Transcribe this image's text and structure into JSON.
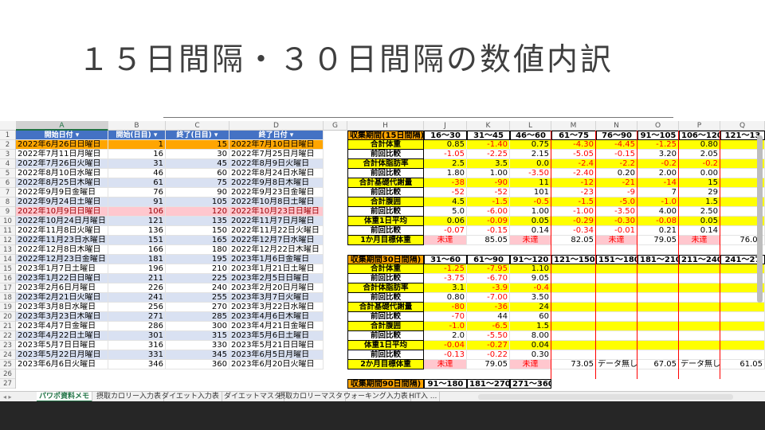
{
  "slide": {
    "title": "１５日間隔・３０日間隔の数値内訳"
  },
  "columns": [
    "A",
    "B",
    "C",
    "D",
    "G",
    "H",
    "J",
    "K",
    "L",
    "M",
    "N",
    "O",
    "P",
    "Q"
  ],
  "rows": [
    "1",
    "2",
    "3",
    "4",
    "5",
    "6",
    "7",
    "8",
    "9",
    "10",
    "11",
    "12",
    "13",
    "14",
    "15",
    "16",
    "17",
    "18",
    "19",
    "20",
    "21",
    "22",
    "23",
    "24",
    "25",
    "26",
    "27"
  ],
  "table_left": {
    "headers": [
      "開始日付",
      "開始(日目)",
      "終了(日目)",
      "終了日付"
    ],
    "rows": [
      [
        "2022年6月26日日曜日",
        "1",
        "15",
        "2022年7月10日日曜日"
      ],
      [
        "2022年7月11日月曜日",
        "16",
        "30",
        "2022年7月25日月曜日"
      ],
      [
        "2022年7月26日火曜日",
        "31",
        "45",
        "2022年8月9日火曜日"
      ],
      [
        "2022年8月10日水曜日",
        "46",
        "60",
        "2022年8月24日水曜日"
      ],
      [
        "2022年8月25日木曜日",
        "61",
        "75",
        "2022年9月8日木曜日"
      ],
      [
        "2022年9月9日金曜日",
        "76",
        "90",
        "2022年9月23日金曜日"
      ],
      [
        "2022年9月24日土曜日",
        "91",
        "105",
        "2022年10月8日土曜日"
      ],
      [
        "2022年10月9日日曜日",
        "106",
        "120",
        "2022年10月23日日曜日"
      ],
      [
        "2022年10月24日月曜日",
        "121",
        "135",
        "2022年11月7日月曜日"
      ],
      [
        "2022年11月8日火曜日",
        "136",
        "150",
        "2022年11月22日火曜日"
      ],
      [
        "2022年11月23日水曜日",
        "151",
        "165",
        "2022年12月7日水曜日"
      ],
      [
        "2022年12月8日木曜日",
        "166",
        "180",
        "2022年12月22日木曜日"
      ],
      [
        "2022年12月23日金曜日",
        "181",
        "195",
        "2023年1月6日金曜日"
      ],
      [
        "2023年1月7日土曜日",
        "196",
        "210",
        "2023年1月21日土曜日"
      ],
      [
        "2023年1月22日日曜日",
        "211",
        "225",
        "2023年2月5日日曜日"
      ],
      [
        "2023年2月6日月曜日",
        "226",
        "240",
        "2023年2月20日月曜日"
      ],
      [
        "2023年2月21日火曜日",
        "241",
        "255",
        "2023年3月7日火曜日"
      ],
      [
        "2023年3月8日水曜日",
        "256",
        "270",
        "2023年3月22日水曜日"
      ],
      [
        "2023年3月23日木曜日",
        "271",
        "285",
        "2023年4月6日木曜日"
      ],
      [
        "2023年4月7日金曜日",
        "286",
        "300",
        "2023年4月21日金曜日"
      ],
      [
        "2023年4月22日土曜日",
        "301",
        "315",
        "2023年5月6日土曜日"
      ],
      [
        "2023年5月7日日曜日",
        "316",
        "330",
        "2023年5月21日日曜日"
      ],
      [
        "2023年5月22日月曜日",
        "331",
        "345",
        "2023年6月5日月曜日"
      ],
      [
        "2023年6月6日火曜日",
        "346",
        "360",
        "2023年6月20日火曜日"
      ]
    ]
  },
  "table_15": {
    "header": "収集期間(15日間隔)",
    "periods": [
      "16～30",
      "31～45",
      "46～60",
      "61～75",
      "76～90",
      "91～105",
      "106～120",
      "121～13"
    ],
    "rows": [
      {
        "label": "合計体重",
        "values": [
          "0.85",
          "-1.40",
          "0.75",
          "-4.30",
          "-4.45",
          "-1.25",
          "0.80",
          ""
        ]
      },
      {
        "label": "前回比較",
        "values": [
          "-1.05",
          "-2.25",
          "2.15",
          "-5.05",
          "-0.15",
          "3.20",
          "2.05",
          ""
        ]
      },
      {
        "label": "合計体脂肪率",
        "values": [
          "2.5",
          "3.5",
          "0.0",
          "-2.4",
          "-2.2",
          "-0.2",
          "-0.2",
          ""
        ]
      },
      {
        "label": "前回比較",
        "values": [
          "1.80",
          "1.00",
          "-3.50",
          "-2.40",
          "0.20",
          "2.00",
          "0.00",
          ""
        ]
      },
      {
        "label": "合計基礎代謝量",
        "values": [
          "-38",
          "-90",
          "11",
          "-12",
          "-21",
          "-14",
          "15",
          ""
        ]
      },
      {
        "label": "前回比較",
        "values": [
          "-52",
          "-52",
          "101",
          "-23",
          "-9",
          "7",
          "29",
          ""
        ]
      },
      {
        "label": "合計腹囲",
        "values": [
          "4.5",
          "-1.5",
          "-0.5",
          "-1.5",
          "-5.0",
          "-1.0",
          "1.5",
          ""
        ]
      },
      {
        "label": "前回比較",
        "values": [
          "5.0",
          "-6.00",
          "1.00",
          "-1.00",
          "-3.50",
          "4.00",
          "2.50",
          ""
        ]
      },
      {
        "label": "体重1日平均",
        "values": [
          "0.06",
          "-0.09",
          "0.05",
          "-0.29",
          "-0.30",
          "-0.08",
          "0.05",
          ""
        ]
      },
      {
        "label": "前回比較",
        "values": [
          "-0.07",
          "-0.15",
          "0.14",
          "-0.34",
          "-0.01",
          "0.21",
          "0.14",
          ""
        ]
      },
      {
        "label": "1か月目標体重",
        "values": [
          "未達",
          "85.05",
          "未達",
          "82.05",
          "未達",
          "79.05",
          "未達",
          "76.05"
        ]
      }
    ]
  },
  "table_30": {
    "header": "収集期間30日間隔)",
    "periods": [
      "31～60",
      "61～90",
      "91～120",
      "121～150",
      "151～180",
      "181～210",
      "211～240",
      "241～27"
    ],
    "rows": [
      {
        "label": "合計体重",
        "values": [
          "-1.25",
          "-7.95",
          "1.10",
          "",
          "",
          "",
          "",
          ""
        ]
      },
      {
        "label": "前回比較",
        "values": [
          "-3.75",
          "-6.70",
          "9.05",
          "",
          "",
          "",
          "",
          ""
        ]
      },
      {
        "label": "合計体脂肪率",
        "values": [
          "3.1",
          "-3.9",
          "-0.4",
          "",
          "",
          "",
          "",
          ""
        ]
      },
      {
        "label": "前回比較",
        "values": [
          "0.80",
          "-7.00",
          "3.50",
          "",
          "",
          "",
          "",
          ""
        ]
      },
      {
        "label": "合計基礎代謝量",
        "values": [
          "-80",
          "-36",
          "24",
          "",
          "",
          "",
          "",
          ""
        ]
      },
      {
        "label": "前回比較",
        "values": [
          "-70",
          "44",
          "60",
          "",
          "",
          "",
          "",
          ""
        ]
      },
      {
        "label": "合計腹囲",
        "values": [
          "-1.0",
          "-6.5",
          "1.5",
          "",
          "",
          "",
          "",
          ""
        ]
      },
      {
        "label": "前回比較",
        "values": [
          "2.0",
          "-5.50",
          "8.00",
          "",
          "",
          "",
          "",
          ""
        ]
      },
      {
        "label": "体重1日平均",
        "values": [
          "-0.04",
          "-0.27",
          "0.04",
          "",
          "",
          "",
          "",
          ""
        ]
      },
      {
        "label": "前回比較",
        "values": [
          "-0.13",
          "-0.22",
          "0.30",
          "",
          "",
          "",
          "",
          ""
        ]
      },
      {
        "label": "2か月目標体重",
        "values": [
          "未達",
          "79.05",
          "未達",
          "73.05",
          "データ無し",
          "67.05",
          "データ無し",
          "61.05"
        ]
      }
    ]
  },
  "table_90": {
    "header": "収集期間90日間隔)",
    "periods": [
      "91～180",
      "181～270",
      "271～360"
    ]
  },
  "tabs": [
    "パワポ資料メモ",
    "摂取カロリー入力表",
    "ダイエット入力表",
    "ダイエットマスタ",
    "摂取カロリーマスタ",
    "ウォーキング入力表",
    "HIT入 ..."
  ],
  "tab_nav": "◂ ▸",
  "colors": {
    "header_blue": "#4472c4",
    "band_blue": "#d9e1f2",
    "highlight_orange": "#ffa500",
    "highlight_pink": "#ffc7ce",
    "yellow": "#ffff00",
    "negative_red": "#ff0000",
    "excel_green": "#217346"
  }
}
